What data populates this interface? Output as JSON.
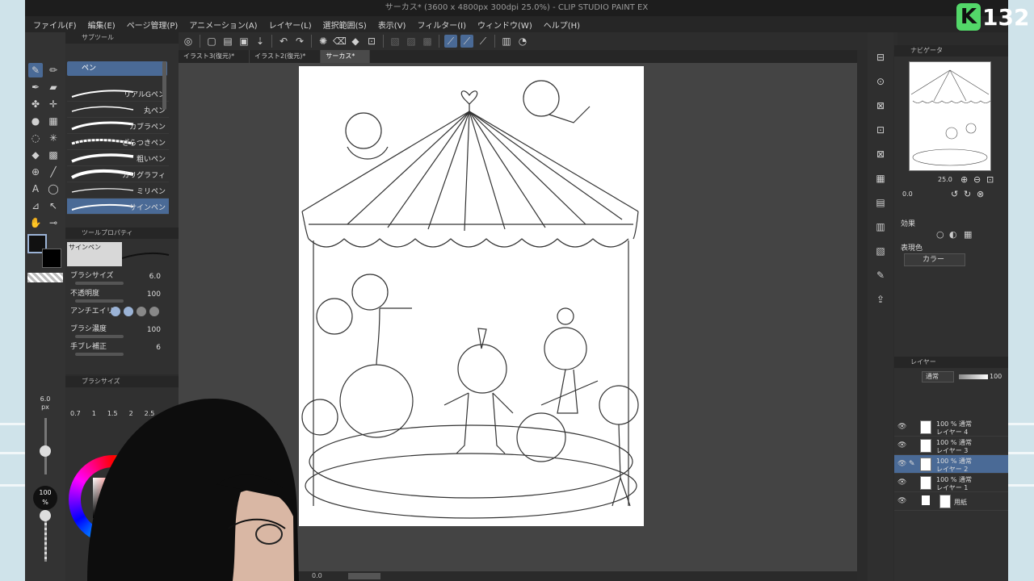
{
  "window": {
    "title": "サーカス* (3600 x 4800px 300dpi 25.0%)  - CLIP STUDIO PAINT EX"
  },
  "menu": [
    "ファイル(F)",
    "編集(E)",
    "ページ管理(P)",
    "アニメーション(A)",
    "レイヤー(L)",
    "選択範囲(S)",
    "表示(V)",
    "フィルター(I)",
    "ウィンドウ(W)",
    "ヘルプ(H)"
  ],
  "tabs": [
    "イラスト3(復元)*",
    "イラスト2(復元)*",
    "サーカス*"
  ],
  "subtool": {
    "header": "サブツール",
    "group": "ペン",
    "brushes": [
      "リアルGペン",
      "丸ペン",
      "カブラペン",
      "ざらつきペン",
      "粗いペン",
      "カリグラフィ",
      "ミリペン",
      "サインペン"
    ]
  },
  "tool_property": {
    "header": "ツールプロパティ",
    "current": "サインペン",
    "rows": [
      {
        "label": "ブラシサイズ",
        "value": "6.0"
      },
      {
        "label": "不透明度",
        "value": "100"
      },
      {
        "label": "アンチエイリ",
        "value": ""
      },
      {
        "label": "ブラシ濃度",
        "value": "100"
      },
      {
        "label": "手ブレ補正",
        "value": "6"
      }
    ]
  },
  "brush_size": {
    "header": "ブラシサイズ",
    "current": "6.0",
    "unit": "px",
    "sizes": [
      "0.7",
      "1",
      "1.5",
      "2",
      "2.5"
    ]
  },
  "color": {
    "opacity_label": "100",
    "opacity_unit": "%"
  },
  "navigator": {
    "header": "ナビゲータ",
    "zoom": "25.0",
    "rotation": "0.0"
  },
  "effect": {
    "header": "効果",
    "display_color_label": "表現色",
    "display_color_value": "カラー"
  },
  "layers": {
    "header": "レイヤー",
    "blend_mode": "通常",
    "opacity": "100",
    "items": [
      {
        "mode": "100 % 通常",
        "name": "レイヤー 4",
        "active": false
      },
      {
        "mode": "100 % 通常",
        "name": "レイヤー 3",
        "active": false
      },
      {
        "mode": "100 % 通常",
        "name": "レイヤー 2",
        "active": true
      },
      {
        "mode": "100 % 通常",
        "name": "レイヤー 1",
        "active": false
      },
      {
        "mode": "",
        "name": "用紙",
        "active": false
      }
    ]
  },
  "status": {
    "zoom": "0.0"
  },
  "overlay": {
    "badge_letter": "K",
    "badge_number": "132"
  },
  "colors": {
    "accent": "#4a6a96",
    "main_color": "#111111",
    "badge_green": "#53d769"
  }
}
